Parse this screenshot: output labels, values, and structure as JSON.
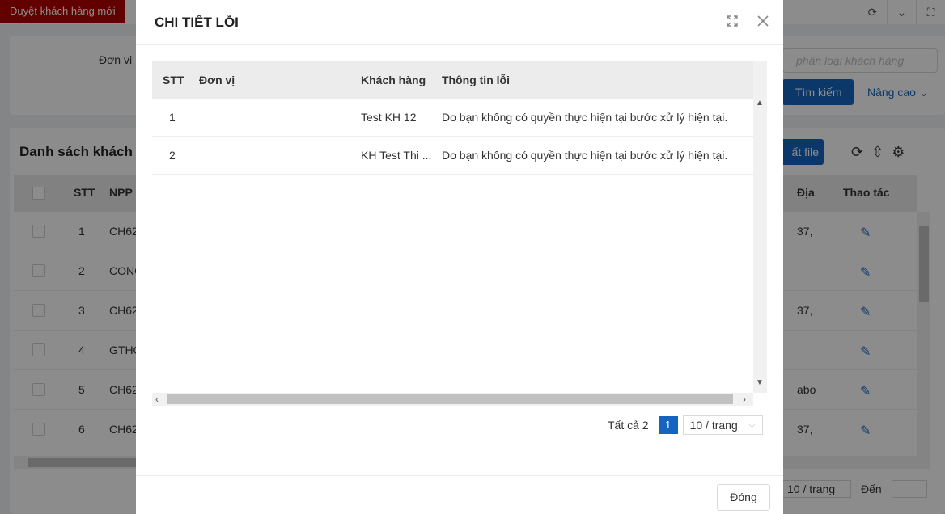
{
  "background": {
    "top_tab": "Duyệt khách hàng mới",
    "filter": {
      "label": "Đơn vị",
      "input_placeholder": "phân loại khách hàng",
      "search_button": "Tìm kiếm",
      "advanced_button": "Nâng cao"
    },
    "list": {
      "title": "Danh sách khách h",
      "export_button": "ất file",
      "columns": {
        "stt": "STT",
        "npp": "NPP",
        "address": "Địa",
        "actions": "Thao tác"
      },
      "rows": [
        {
          "stt": "1",
          "npp": "CH62",
          "address": "37,"
        },
        {
          "stt": "2",
          "npp": "CONG",
          "address": ""
        },
        {
          "stt": "3",
          "npp": "CH62",
          "address": "37,"
        },
        {
          "stt": "4",
          "npp": "GTHO",
          "address": ""
        },
        {
          "stt": "5",
          "npp": "CH62",
          "address": "abo"
        },
        {
          "stt": "6",
          "npp": "CH62",
          "address": "37,"
        }
      ],
      "page_size": "10 / trang",
      "goto_label": "Đến"
    }
  },
  "modal": {
    "title": "CHI TIẾT LỖI",
    "columns": {
      "stt": "STT",
      "unit": "Đơn vị",
      "customer": "Khách hàng",
      "error": "Thông tin lỗi"
    },
    "rows": [
      {
        "stt": "1",
        "unit": "",
        "customer": "Test KH 12",
        "error": "Do bạn không có quyền thực hiện tại bước xử lý hiện tại."
      },
      {
        "stt": "2",
        "unit": "",
        "customer": "KH Test Thi ...",
        "error": "Do bạn không có quyền thực hiện tại bước xử lý hiện tại."
      }
    ],
    "pagination": {
      "total_label": "Tất cả 2",
      "current_page": "1",
      "page_size": "10 / trang"
    },
    "close_button": "Đóng"
  },
  "colors": {
    "primary": "#1565c0",
    "tab_red": "#b30000"
  }
}
